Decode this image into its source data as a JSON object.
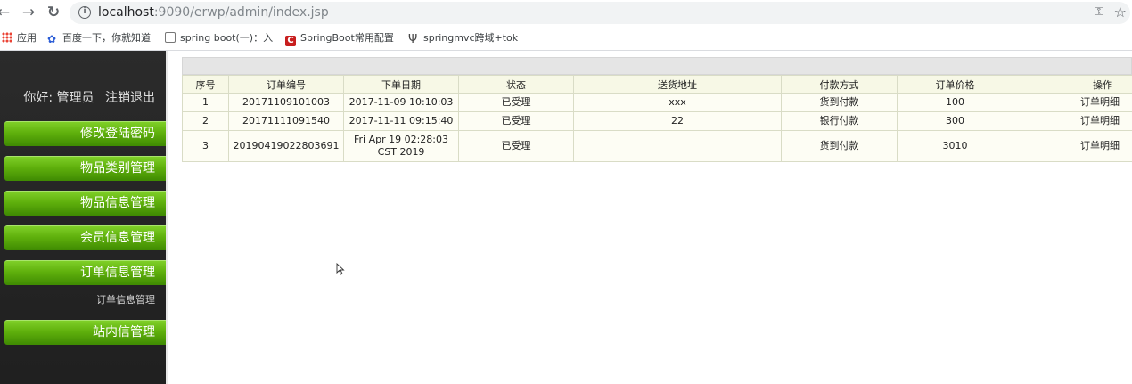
{
  "browser": {
    "nav": {
      "back": "←",
      "forward": "→",
      "reload": "C"
    },
    "url_host": "localhost",
    "url_path": ":9090/erwp/admin/index.jsp",
    "bookmarks": [
      {
        "label": "应用",
        "icon": "apps-icon"
      },
      {
        "label": "百度一下，你就知道",
        "icon": "baidu-paw-icon"
      },
      {
        "label": "spring boot(一)：入",
        "icon": "page-icon"
      },
      {
        "label": "SpringBoot常用配置",
        "icon": "c-icon"
      },
      {
        "label": "springmvc跨域+tok",
        "icon": "s-icon"
      }
    ]
  },
  "sidebar": {
    "greeting": "你好: 管理员",
    "logout": "注销退出",
    "menu": [
      {
        "label": "修改登陆密码"
      },
      {
        "label": "物品类别管理"
      },
      {
        "label": "物品信息管理"
      },
      {
        "label": "会员信息管理"
      },
      {
        "label": "订单信息管理"
      },
      {
        "label": "站内信管理"
      }
    ],
    "submenu_label": "订单信息管理"
  },
  "table": {
    "columns": [
      "序号",
      "订单编号",
      "下单日期",
      "状态",
      "送货地址",
      "付款方式",
      "订单价格",
      "操作"
    ],
    "rows": [
      {
        "no": "1",
        "order_id": "20171109101003",
        "date": "2017-11-09 10:10:03",
        "status": "已受理",
        "address": "xxx",
        "payment": "货到付款",
        "price": "100",
        "action": "订单明细"
      },
      {
        "no": "2",
        "order_id": "20171111091540",
        "date": "2017-11-11 09:15:40",
        "status": "已受理",
        "address": "22",
        "payment": "银行付款",
        "price": "300",
        "action": "订单明细"
      },
      {
        "no": "3",
        "order_id": "20190419022803691",
        "date": "Fri Apr 19 02:28:03 CST 2019",
        "status": "已受理",
        "address": "",
        "payment": "货到付款",
        "price": "3010",
        "action": "订单明细"
      }
    ]
  },
  "colors": {
    "menu_green": "#5fb00c",
    "sidebar_bg": "#2b2b2b",
    "header_bar": "#e5e5e5"
  }
}
